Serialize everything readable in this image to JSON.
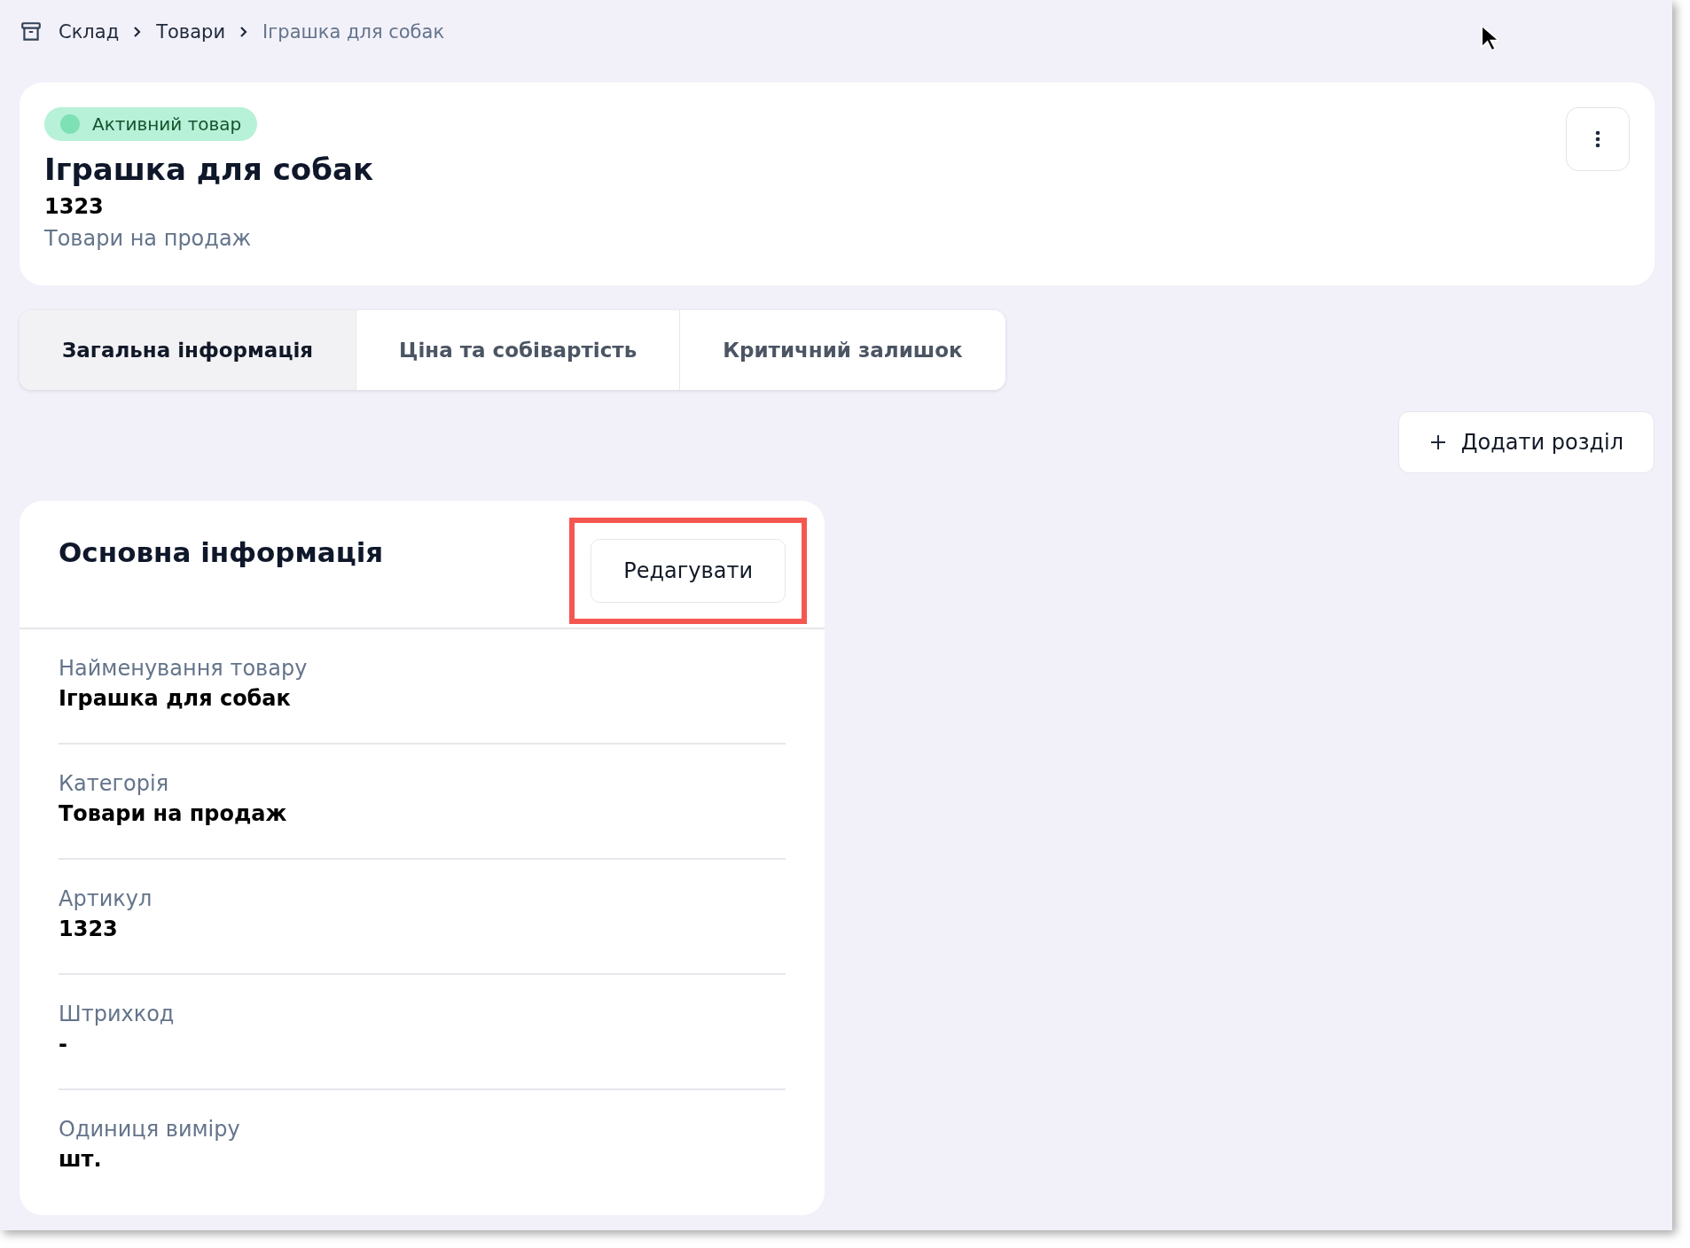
{
  "breadcrumbs": [
    {
      "label": "Склад",
      "current": false
    },
    {
      "label": "Товари",
      "current": false
    },
    {
      "label": "Іграшка для собак",
      "current": true
    }
  ],
  "product": {
    "status": {
      "label": "Активний товар",
      "color": "#7ee0b5"
    },
    "title": "Іграшка для собак",
    "sku": "1323",
    "category": "Товари на продаж"
  },
  "tabs": [
    {
      "label": "Загальна інформація",
      "selected": true
    },
    {
      "label": "Ціна та собівартість",
      "selected": false
    },
    {
      "label": "Критичний залишок",
      "selected": false
    }
  ],
  "add_section_button": {
    "label": "Додати розділ"
  },
  "info_card": {
    "title": "Основна інформація",
    "edit_button": {
      "label": "Редагувати",
      "highlighted": true
    },
    "fields": [
      {
        "label": "Найменування товару",
        "value": "Іграшка для собак"
      },
      {
        "label": "Категорія",
        "value": "Товари на продаж"
      },
      {
        "label": "Артикул",
        "value": "1323"
      },
      {
        "label": "Штрихкод",
        "value": "-"
      },
      {
        "label": "Одиниця виміру",
        "value": "шт."
      }
    ]
  }
}
